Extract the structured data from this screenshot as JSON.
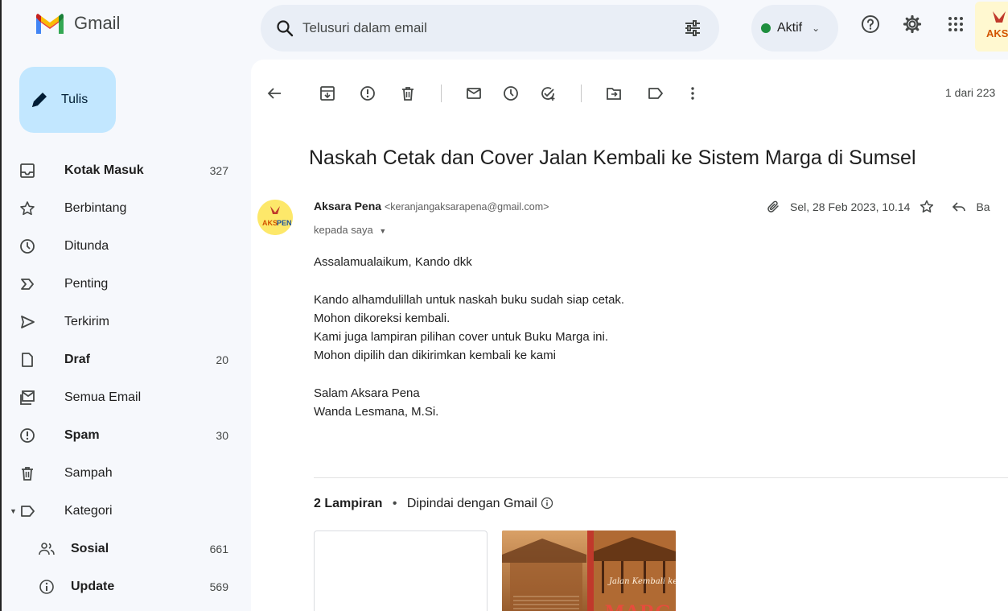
{
  "app": {
    "name": "Gmail",
    "compose_label": "Tulis"
  },
  "search": {
    "placeholder": "Telusuri dalam email"
  },
  "status": {
    "label": "Aktif",
    "color": "#1e8e3e"
  },
  "topbar_icons": [
    "help-icon",
    "settings-gear-icon",
    "apps-grid-icon"
  ],
  "sidebar": {
    "items": [
      {
        "label": "Kotak Masuk",
        "count": "327",
        "icon": "inbox-icon",
        "bold": true
      },
      {
        "label": "Berbintang",
        "count": "",
        "icon": "star-icon",
        "bold": false
      },
      {
        "label": "Ditunda",
        "count": "",
        "icon": "clock-icon",
        "bold": false
      },
      {
        "label": "Penting",
        "count": "",
        "icon": "important-icon",
        "bold": false
      },
      {
        "label": "Terkirim",
        "count": "",
        "icon": "send-icon",
        "bold": false
      },
      {
        "label": "Draf",
        "count": "20",
        "icon": "draft-icon",
        "bold": true
      },
      {
        "label": "Semua Email",
        "count": "",
        "icon": "all-mail-icon",
        "bold": false
      },
      {
        "label": "Spam",
        "count": "30",
        "icon": "spam-icon",
        "bold": true
      },
      {
        "label": "Sampah",
        "count": "",
        "icon": "trash-icon",
        "bold": false
      },
      {
        "label": "Kategori",
        "count": "",
        "icon": "label-icon",
        "bold": false
      },
      {
        "label": "Sosial",
        "count": "661",
        "icon": "social-icon",
        "bold": true
      },
      {
        "label": "Update",
        "count": "569",
        "icon": "info-icon",
        "bold": true
      }
    ]
  },
  "toolbar": {
    "pager": "1 dari 223"
  },
  "email": {
    "subject": "Naskah Cetak dan Cover Jalan Kembali ke Sistem Marga di Sumsel",
    "sender_name": "Aksara Pena",
    "sender_email": "<keranjangaksarapena@gmail.com>",
    "to": "kepada saya",
    "date": "Sel, 28 Feb 2023, 10.14",
    "reply_partial": "Ba",
    "body": [
      "Assalamualaikum, Kando dkk",
      "",
      "Kando alhamdulillah untuk naskah buku sudah siap cetak.",
      "Mohon dikoreksi kembali.",
      "Kami juga lampiran pilihan cover untuk Buku Marga ini.",
      "Mohon dipilih dan dikirimkan kembali ke kami",
      "",
      "Salam Aksara Pena",
      "Wanda Lesmana, M.Si."
    ]
  },
  "attachments": {
    "count_label": "2 Lampiran",
    "scan_label": "Dipindai dengan Gmail",
    "cover_title": "MARGA"
  },
  "avatar_text": "AKSPEN"
}
